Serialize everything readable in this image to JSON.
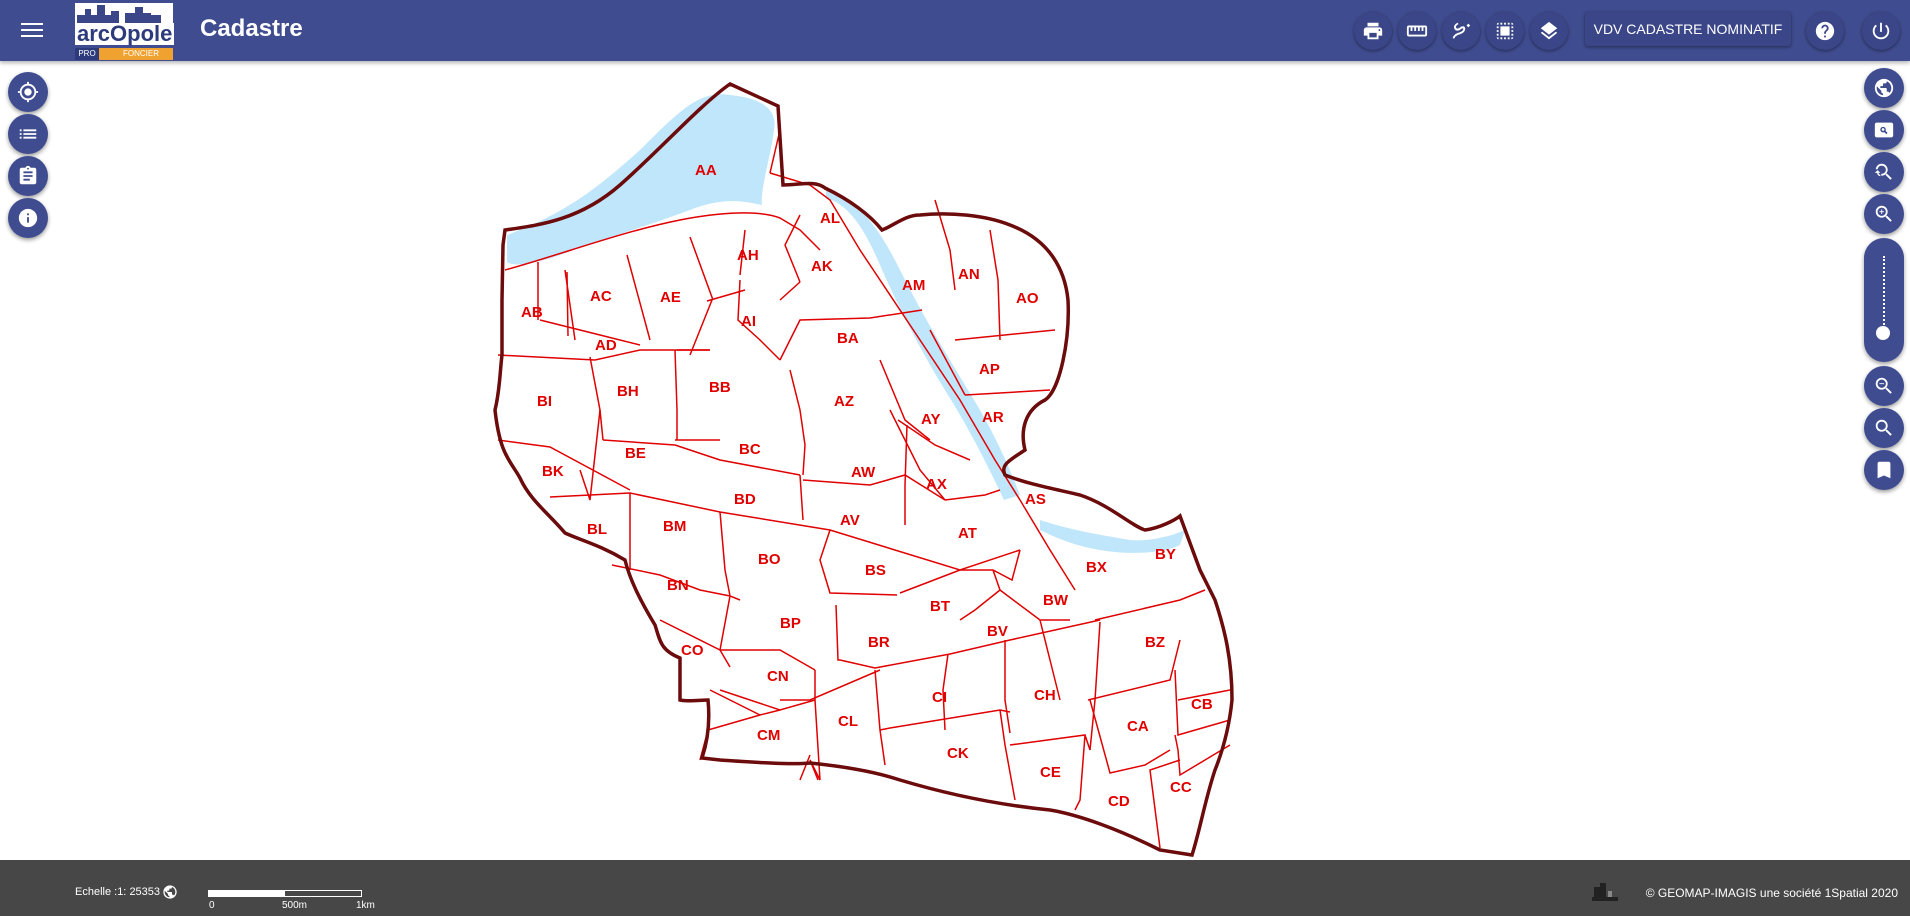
{
  "header": {
    "title": "Cadastre",
    "logo_text": "arcOpole",
    "logo_sub_pro": "PRO",
    "logo_sub_foncier": "FONCIER",
    "mode_button": "VDV CADASTRE NOMINATIF",
    "toolbar_icons": [
      "print-icon",
      "ruler-icon",
      "draw-icon",
      "select-area-icon",
      "layers-icon"
    ],
    "right_icons": [
      "help-icon",
      "power-icon"
    ]
  },
  "left_tools": [
    "locate-icon",
    "list-icon",
    "clipboard-icon",
    "info-icon"
  ],
  "right_tools": [
    "globe-icon",
    "search-box-icon",
    "zoom-previous-icon",
    "zoom-in-icon",
    "zoom-out-icon",
    "search-icon",
    "bookmark-icon"
  ],
  "map": {
    "parcels": [
      "AA",
      "AL",
      "AH",
      "AK",
      "AM",
      "AN",
      "AO",
      "AB",
      "AC",
      "AE",
      "AD",
      "AI",
      "BA",
      "AP",
      "BI",
      "BH",
      "BB",
      "AZ",
      "AY",
      "AR",
      "BK",
      "BE",
      "BC",
      "AW",
      "AX",
      "AS",
      "BD",
      "BL",
      "BM",
      "AV",
      "AT",
      "BY",
      "BX",
      "BO",
      "BS",
      "BN",
      "BT",
      "BW",
      "BP",
      "BV",
      "BZ",
      "CO",
      "BR",
      "CN",
      "CI",
      "CH",
      "CB",
      "CL",
      "CA",
      "CM",
      "CK",
      "CE",
      "CC",
      "CD"
    ],
    "colors": {
      "boundary": "#6b0b0b",
      "parcel_line": "#e00000",
      "water": "#bfe6fb"
    }
  },
  "footer": {
    "scale_label": "Echelle :1:",
    "scale_value": "25353",
    "scalebar_labels": [
      "0",
      "500m",
      "1km"
    ],
    "copyright": "© GEOMAP-IMAGIS une société 1Spatial 2020"
  }
}
